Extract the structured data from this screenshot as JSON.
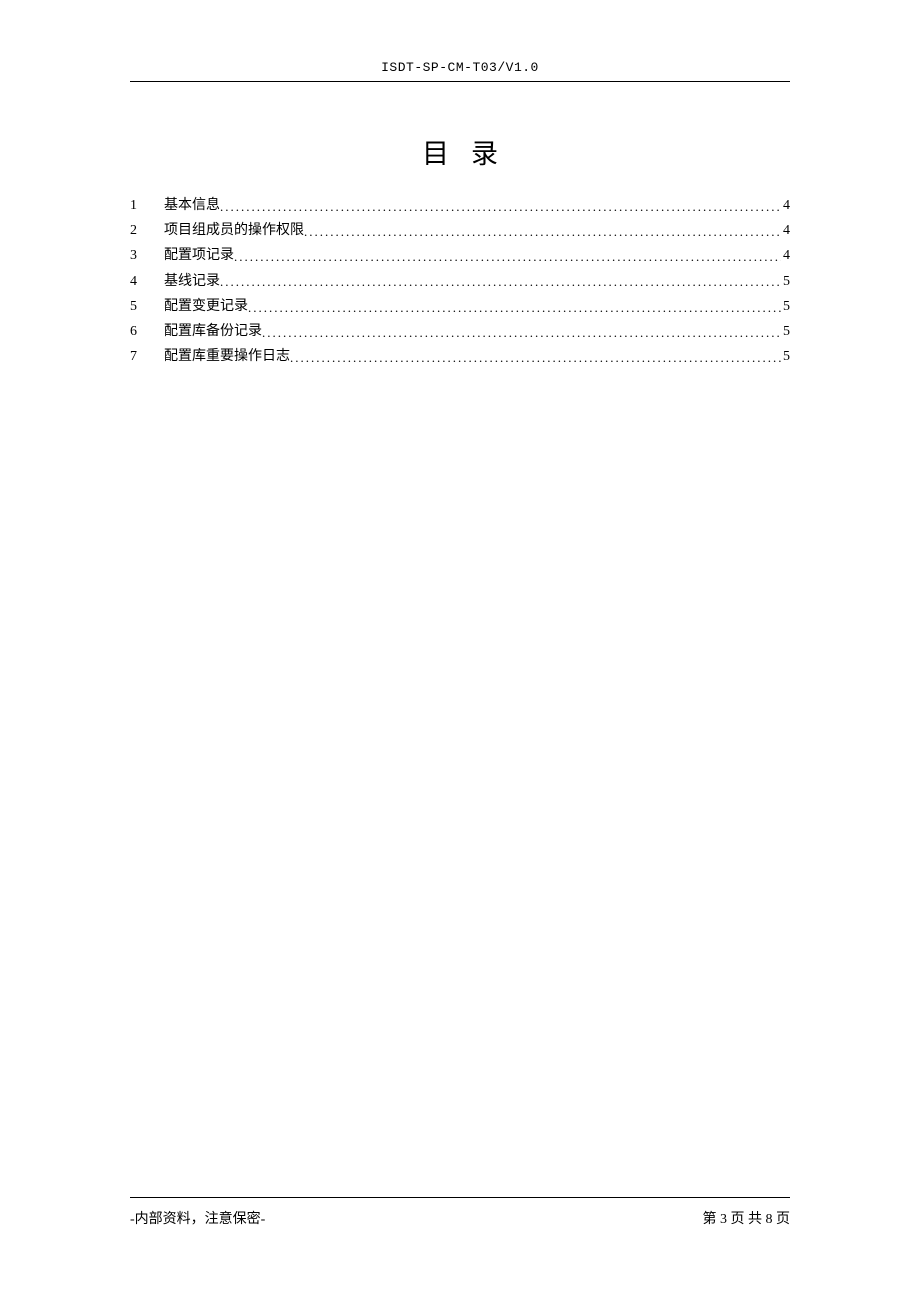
{
  "header": {
    "doc_id": "ISDT-SP-CM-T03/V1.0"
  },
  "title": {
    "char1": "目",
    "char2": "录"
  },
  "toc": {
    "items": [
      {
        "num": "1",
        "label": "基本信息",
        "page": "4"
      },
      {
        "num": "2",
        "label": "项目组成员的操作权限",
        "page": "4"
      },
      {
        "num": "3",
        "label": "配置项记录",
        "page": "4"
      },
      {
        "num": "4",
        "label": "基线记录",
        "page": "5"
      },
      {
        "num": "5",
        "label": "配置变更记录",
        "page": "5"
      },
      {
        "num": "6",
        "label": "配置库备份记录",
        "page": "5"
      },
      {
        "num": "7",
        "label": "配置库重要操作日志",
        "page": "5"
      }
    ]
  },
  "footer": {
    "left": "-内部资料，注意保密-",
    "right_prefix": "第 ",
    "page_current": "3",
    "right_mid": " 页 共 ",
    "page_total": "8",
    "right_suffix": " 页"
  }
}
